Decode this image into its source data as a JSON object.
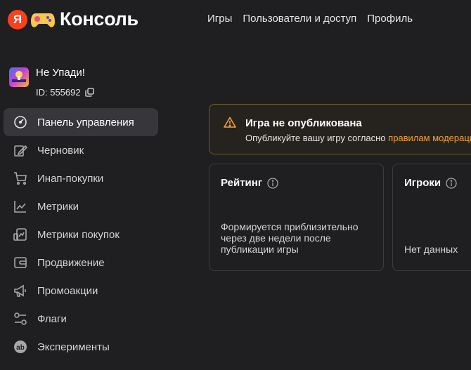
{
  "header": {
    "logo_letter": "Я",
    "logo_text": "Консоль",
    "nav": [
      "Игры",
      "Пользователи и доступ",
      "Профиль"
    ]
  },
  "game": {
    "name": "Не Упади!",
    "id_label": "ID: 555692"
  },
  "sidebar": {
    "items": [
      {
        "label": "Панель управления",
        "icon": "dashboard-gauge-icon",
        "active": true
      },
      {
        "label": "Черновик",
        "icon": "edit-draft-icon"
      },
      {
        "label": "Инап-покупки",
        "icon": "cart-icon"
      },
      {
        "label": "Метрики",
        "icon": "line-chart-icon"
      },
      {
        "label": "Метрики покупок",
        "icon": "purchase-metrics-icon"
      },
      {
        "label": "Продвижение",
        "icon": "wallet-icon"
      },
      {
        "label": "Промоакции",
        "icon": "megaphone-icon"
      },
      {
        "label": "Флаги",
        "icon": "flags-toggle-icon"
      },
      {
        "label": "Эксперименты",
        "icon": "ab-test-icon"
      }
    ]
  },
  "alert": {
    "title": "Игра не опубликована",
    "text": "Опубликуйте вашу игру согласно ",
    "link": "правилам модерации"
  },
  "cards": [
    {
      "title": "Рейтинг",
      "body": "Формируется приблизительно через две недели после публикации игры"
    },
    {
      "title": "Игроки",
      "body": "Нет данных"
    }
  ],
  "colors": {
    "background": "#1f1e21",
    "accent_link": "#f5a23a",
    "alert_border": "#6e5a2e",
    "yandex_red": "#fc3f1d"
  }
}
